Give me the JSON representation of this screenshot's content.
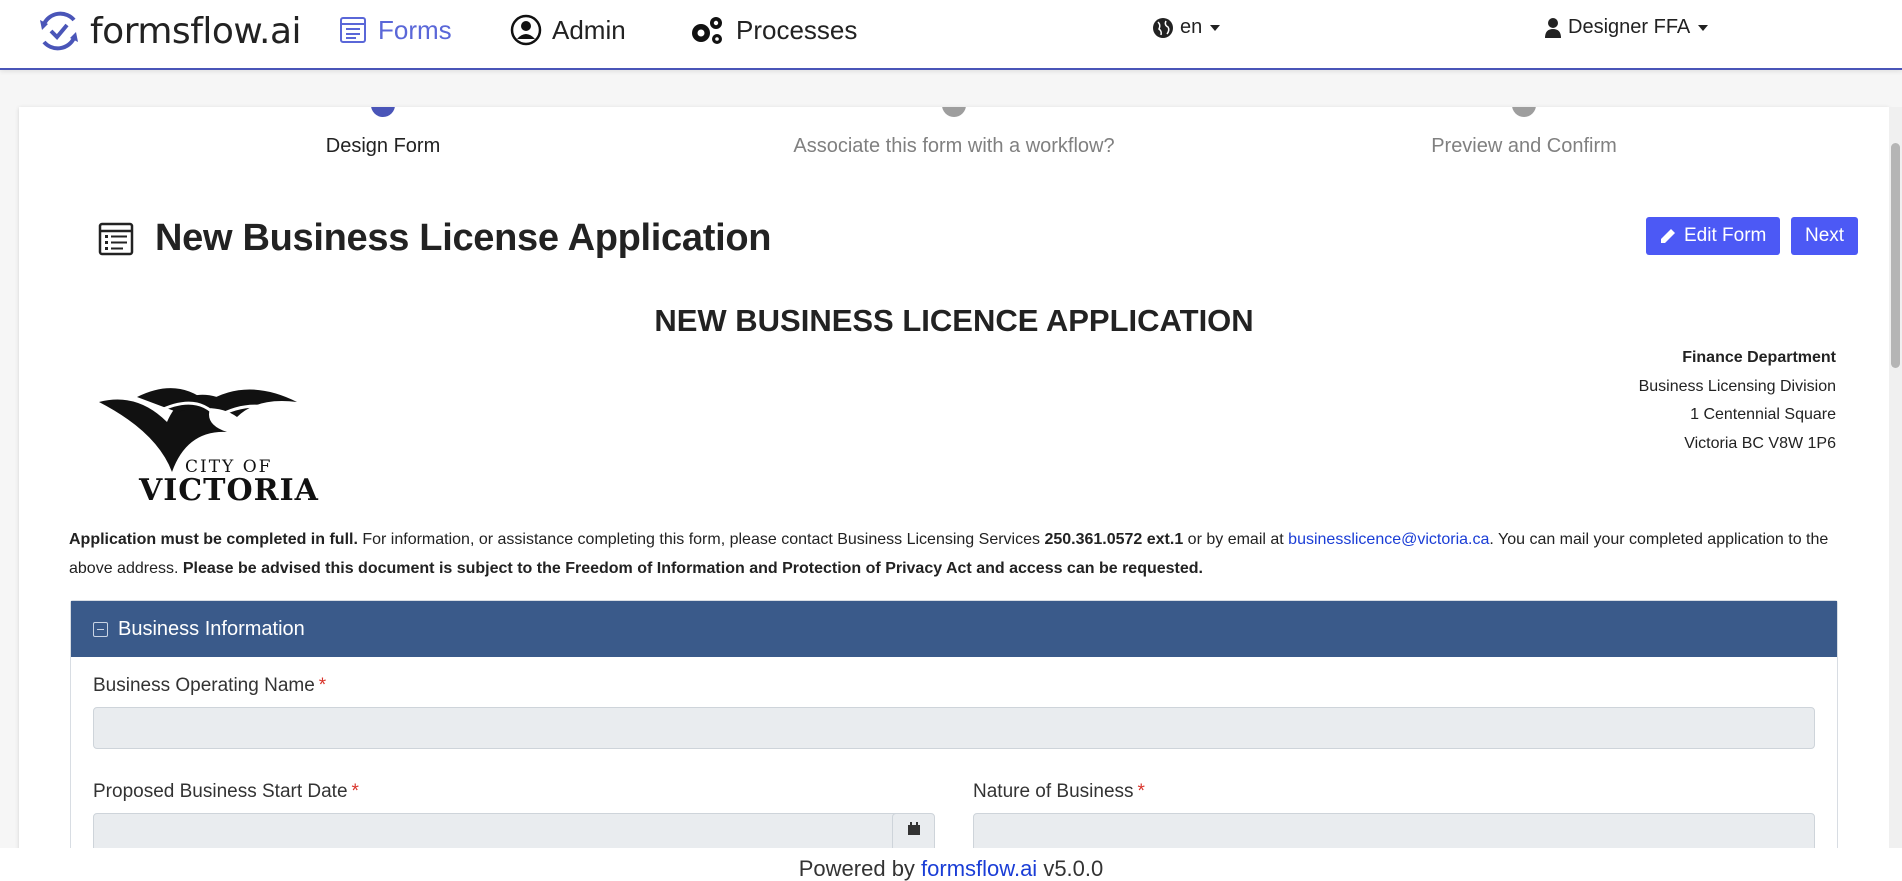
{
  "nav": {
    "brand": "formsflow.ai",
    "items": [
      {
        "label": "Forms",
        "icon": "forms-icon"
      },
      {
        "label": "Admin",
        "icon": "user-circle-icon"
      },
      {
        "label": "Processes",
        "icon": "gears-icon"
      }
    ],
    "language": "en",
    "user": "Designer FFA"
  },
  "stepper": {
    "steps": [
      "Design Form",
      "Associate this form with a workflow?",
      "Preview and Confirm"
    ],
    "active": 0
  },
  "page": {
    "title": "New Business License Application",
    "edit_label": "Edit Form",
    "next_label": "Next"
  },
  "form": {
    "heading": "NEW BUSINESS LICENCE APPLICATION",
    "logo_text": [
      "CITY OF",
      "VICTORIA"
    ],
    "address": {
      "department": "Finance Department",
      "division": "Business Licensing Division",
      "street": "1 Centennial Square",
      "city": "Victoria BC V8W 1P6"
    },
    "intro": {
      "bold_lead": "Application must be completed in full.",
      "text1": " For information, or assistance completing this form, please contact Business Licensing Services ",
      "phone": "250.361.0572 ext.1",
      "text2": " or by email at ",
      "email": "businesslicence@victoria.ca",
      "text3": ". You can mail your completed application to the above address. ",
      "bold_tail": "Please be advised this document is subject to the Freedom of Information and Protection of Privacy Act and access can be requested."
    },
    "panel_title": "Business Information",
    "fields": {
      "operating_name": "Business Operating Name",
      "start_date": "Proposed Business Start Date",
      "nature": "Nature of Business",
      "required_mark": "*"
    }
  },
  "footer": {
    "prefix": "Powered by ",
    "link": "formsflow.ai",
    "version": " v5.0.0"
  },
  "colors": {
    "accent": "#4a55b8",
    "button": "#4c59f5",
    "panel_header": "#3a5a8a",
    "required": "#d9342b"
  }
}
